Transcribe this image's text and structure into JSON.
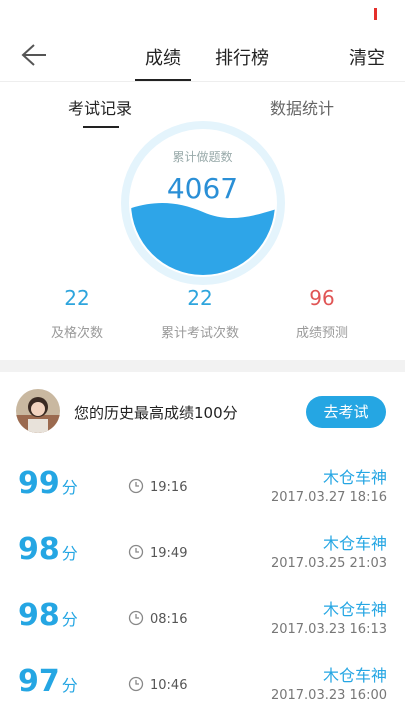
{
  "nav": {
    "tabs": [
      "成绩",
      "排行榜"
    ],
    "clear_label": "清空"
  },
  "subtabs": [
    "考试记录",
    "数据统计"
  ],
  "gauge": {
    "label": "累计做题数",
    "value": "4067"
  },
  "metrics": [
    {
      "value": "22",
      "label": "及格次数"
    },
    {
      "value": "22",
      "label": "累计考试次数"
    },
    {
      "value": "96",
      "label": "成绩预测"
    }
  ],
  "best": {
    "text": "您的历史最高成绩100分",
    "button_label": "去考试"
  },
  "records": [
    {
      "score": "99",
      "unit": "分",
      "time": "19:16",
      "car": "木仓车神",
      "date": "2017.03.27  18:16"
    },
    {
      "score": "98",
      "unit": "分",
      "time": "19:49",
      "car": "木仓车神",
      "date": "2017.03.25  21:03"
    },
    {
      "score": "98",
      "unit": "分",
      "time": "08:16",
      "car": "木仓车神",
      "date": "2017.03.23  16:13"
    },
    {
      "score": "97",
      "unit": "分",
      "time": "10:46",
      "car": "木仓车神",
      "date": "2017.03.23  16:00"
    }
  ],
  "colors": {
    "accent": "#25a6e3",
    "predict": "#e05555"
  }
}
